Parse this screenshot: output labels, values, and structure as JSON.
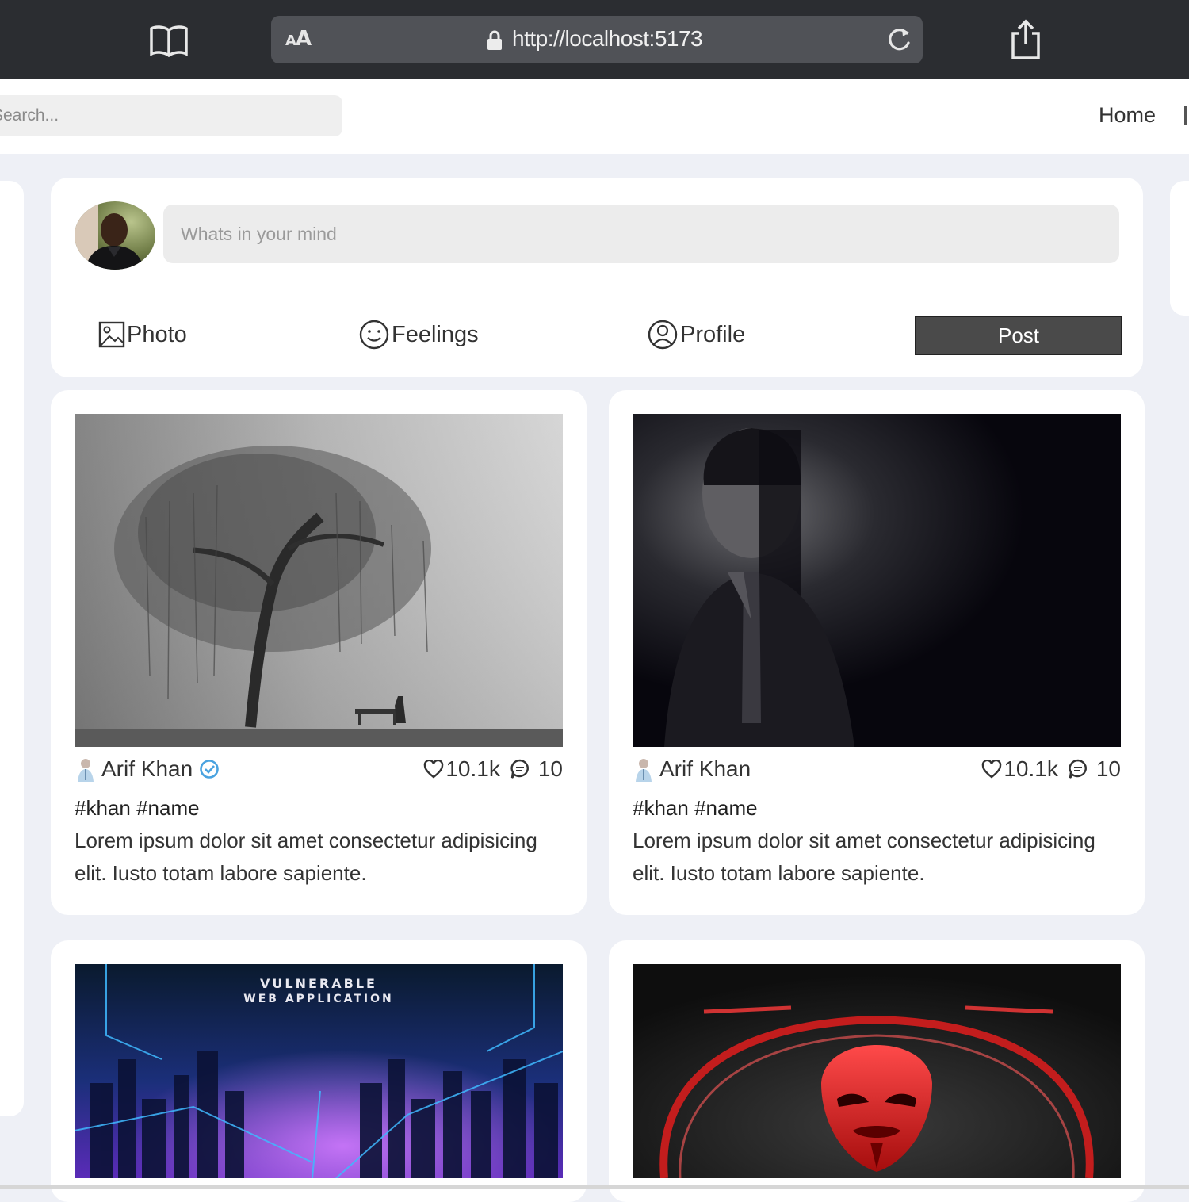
{
  "browser": {
    "text_size_label": "AA",
    "url": "http://localhost:5173"
  },
  "header": {
    "search_placeholder": "Search...",
    "nav": [
      "Home"
    ]
  },
  "composer": {
    "placeholder": "Whats in your mind",
    "actions": [
      {
        "label": "Photo",
        "icon": "image-icon"
      },
      {
        "label": "Feelings",
        "icon": "smiley-icon"
      },
      {
        "label": "Profile",
        "icon": "user-circle-icon"
      }
    ],
    "post_label": "Post"
  },
  "posts": [
    {
      "author": "Arif Khan",
      "verified": true,
      "likes": "10.1k",
      "comments": "10",
      "tags": "#khan #name",
      "caption": "Lorem ipsum dolor sit amet consectetur adipisicing elit. Iusto totam labore sapiente.",
      "image": "foggy-willow-tree-photo"
    },
    {
      "author": "Arif Khan",
      "verified": false,
      "likes": "10.1k",
      "comments": "10",
      "tags": "#khan #name",
      "caption": "Lorem ipsum dolor sit amet consectetur adipisicing elit. Iusto totam labore sapiente.",
      "image": "man-in-shadow-portrait-photo"
    },
    {
      "image": "vulnerable-web-application-banner",
      "image_text": [
        "VULNERABLE",
        "WEB APPLICATION"
      ]
    },
    {
      "image": "red-mask-hacker-image"
    }
  ],
  "colors": {
    "chrome": "#2b2d31",
    "page_background": "#eef0f6",
    "post_button": "#4a4a4a",
    "verified": "#4aa3e0"
  }
}
